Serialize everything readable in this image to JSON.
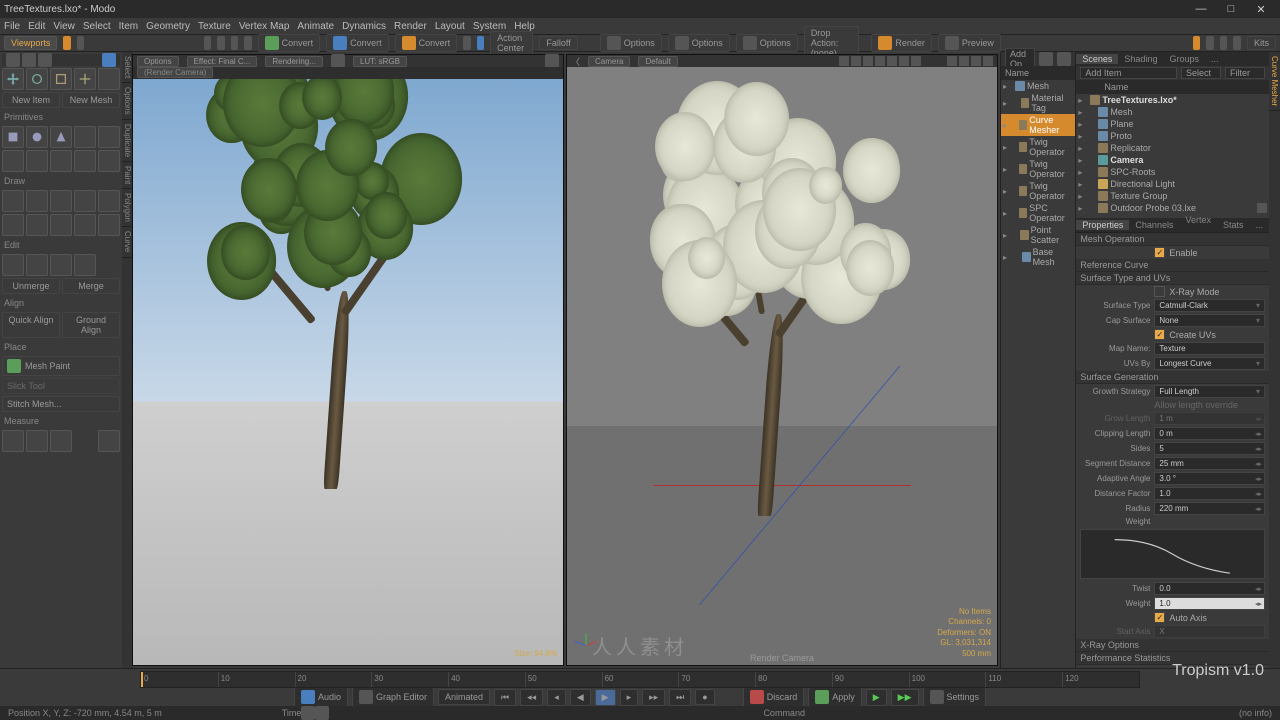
{
  "title": "TreeTextures.lxo* - Modo",
  "menus": [
    "File",
    "Edit",
    "View",
    "Select",
    "Item",
    "Geometry",
    "Texture",
    "Vertex Map",
    "Animate",
    "Dynamics",
    "Render",
    "Layout",
    "System",
    "Help"
  ],
  "toolbar": {
    "tab": "Viewports",
    "convert": "Convert",
    "action_center": "Action Center",
    "falloff": "Falloff",
    "options": "Options",
    "drop_action": "Drop Action: (none)",
    "render": "Render",
    "preview": "Preview",
    "kits": "Kits"
  },
  "left": {
    "tabs": [
      "Select",
      "Options",
      "Duplicate",
      "Paint",
      "Polygon",
      "Curve"
    ],
    "section_primitives": "Primitives",
    "section_draw": "Draw",
    "section_edit": "Edit",
    "btn_newitem": "New Item",
    "btn_newmesh": "New Mesh",
    "btn_unmerge": "Unmerge",
    "btn_merge": "Merge",
    "section_align": "Align",
    "btn_quickalign": "Quick Align",
    "btn_groundalign": "Ground Align",
    "section_place": "Place",
    "btn_meshpaint": "Mesh Paint",
    "btn_slicktool": "Slick Tool",
    "btn_stitchmesh": "Stitch Mesh...",
    "section_measure": "Measure"
  },
  "vp1": {
    "options": "Options",
    "effect": "Effect: Final C...",
    "rendering": "Rendering...",
    "lut": "LUT: sRGB",
    "subtab": "(Render Camera)",
    "size": "Size: 94.8%"
  },
  "vp2": {
    "camera": "Camera",
    "default": "Default",
    "status": {
      "lines": [
        "No Items",
        "Channels: 0",
        "Deformers: ON",
        "GL: 3,031,314",
        "500 mm"
      ]
    },
    "bottom": "Render Camera"
  },
  "mesh_panel": {
    "addop": "Add Op...",
    "name": "Name",
    "items": [
      {
        "ind": 0,
        "label": "Mesh",
        "ico": "mesh"
      },
      {
        "ind": 1,
        "label": "Material Tag",
        "ico": "op"
      },
      {
        "ind": 1,
        "label": "Curve Mesher",
        "ico": "op",
        "sel": true
      },
      {
        "ind": 1,
        "label": "Twig Operator",
        "ico": "op"
      },
      {
        "ind": 1,
        "label": "Twig Operator",
        "ico": "op"
      },
      {
        "ind": 1,
        "label": "Twig Operator",
        "ico": "op"
      },
      {
        "ind": 1,
        "label": "SPC Operator",
        "ico": "op"
      },
      {
        "ind": 1,
        "label": "Point Scatter",
        "ico": "op"
      },
      {
        "ind": 1,
        "label": "Base Mesh",
        "ico": "mesh"
      }
    ]
  },
  "scene_panel": {
    "tabs": [
      "Scenes",
      "Shading",
      "Groups",
      "..."
    ],
    "additem": "Add Item",
    "select": "Select",
    "filter": "Filter",
    "name": "Name",
    "items": [
      {
        "ind": 0,
        "label": "TreeTextures.lxo*",
        "ico": "op",
        "bold": true
      },
      {
        "ind": 1,
        "label": "Mesh",
        "ico": "mesh"
      },
      {
        "ind": 1,
        "label": "Plane",
        "ico": "mesh"
      },
      {
        "ind": 1,
        "label": "Proto",
        "ico": "mesh"
      },
      {
        "ind": 1,
        "label": "Replicator",
        "ico": "op"
      },
      {
        "ind": 1,
        "label": "Camera",
        "ico": "cam",
        "bold": true
      },
      {
        "ind": 1,
        "label": "SPC-Roots",
        "ico": "op"
      },
      {
        "ind": 1,
        "label": "Directional Light",
        "ico": "light"
      },
      {
        "ind": 1,
        "label": "Texture Group",
        "ico": "op"
      },
      {
        "ind": 1,
        "label": "Outdoor Probe 03.lxe",
        "ico": "op",
        "eye": true
      }
    ]
  },
  "props": {
    "tabs": [
      "Properties",
      "Channels",
      "Vertex ...",
      "Stats",
      "..."
    ],
    "meshop": "Mesh Operation",
    "enable": "Enable",
    "refcurve": "Reference Curve",
    "surftype": "Surface Type and UVs",
    "xray": "X-Ray Mode",
    "surface_type": {
      "lbl": "Surface Type",
      "val": "Catmull-Clark"
    },
    "cap_surface": {
      "lbl": "Cap Surface",
      "val": "None"
    },
    "create_uvs": "Create UVs",
    "map_name": {
      "lbl": "Map Name:",
      "val": "Texture"
    },
    "uvs_by": {
      "lbl": "UVs By",
      "val": "Longest Curve"
    },
    "surfgen": "Surface Generation",
    "growth": {
      "lbl": "Growth Strategy",
      "val": "Full Length"
    },
    "allow_override": "Allow length override",
    "grow_length": {
      "lbl": "Grow Length",
      "val": "1 m"
    },
    "clipping": {
      "lbl": "Clipping Length",
      "val": "0 m"
    },
    "sides": {
      "lbl": "Sides",
      "val": "5"
    },
    "segdist": {
      "lbl": "Segment Distance",
      "val": "25 mm"
    },
    "adangle": {
      "lbl": "Adaptive Angle",
      "val": "3.0 °"
    },
    "distfact": {
      "lbl": "Distance Factor",
      "val": "1.0"
    },
    "radius": {
      "lbl": "Radius",
      "val": "220 mm"
    },
    "weight": "Weight",
    "twist": {
      "lbl": "Twist",
      "val": "0.0"
    },
    "weight2": {
      "lbl": "Weight",
      "val": "1.0"
    },
    "autoaxis": "Auto Axis",
    "startaxis": {
      "lbl": "Start Axis",
      "val": "X"
    },
    "xrayopts": "X-Ray Options",
    "perfstats": "Performance Statistics"
  },
  "right_strip": "Curve Mesher",
  "timeline": {
    "frames": [
      0,
      10,
      20,
      30,
      40,
      50,
      60,
      70,
      80,
      90,
      100,
      110,
      120
    ]
  },
  "playbar": {
    "audio": "Audio",
    "graph": "Graph Editor",
    "animated": "Animated",
    "discard": "Discard",
    "apply": "Apply",
    "settings": "Settings",
    "time": "Time"
  },
  "status": {
    "left": "Position X, Y, Z:   -720 mm, 4.54 m, 5 m",
    "cmd": "Command",
    "right": "(no info)"
  },
  "version": "Tropism v1.0",
  "watermark": "人人素材"
}
